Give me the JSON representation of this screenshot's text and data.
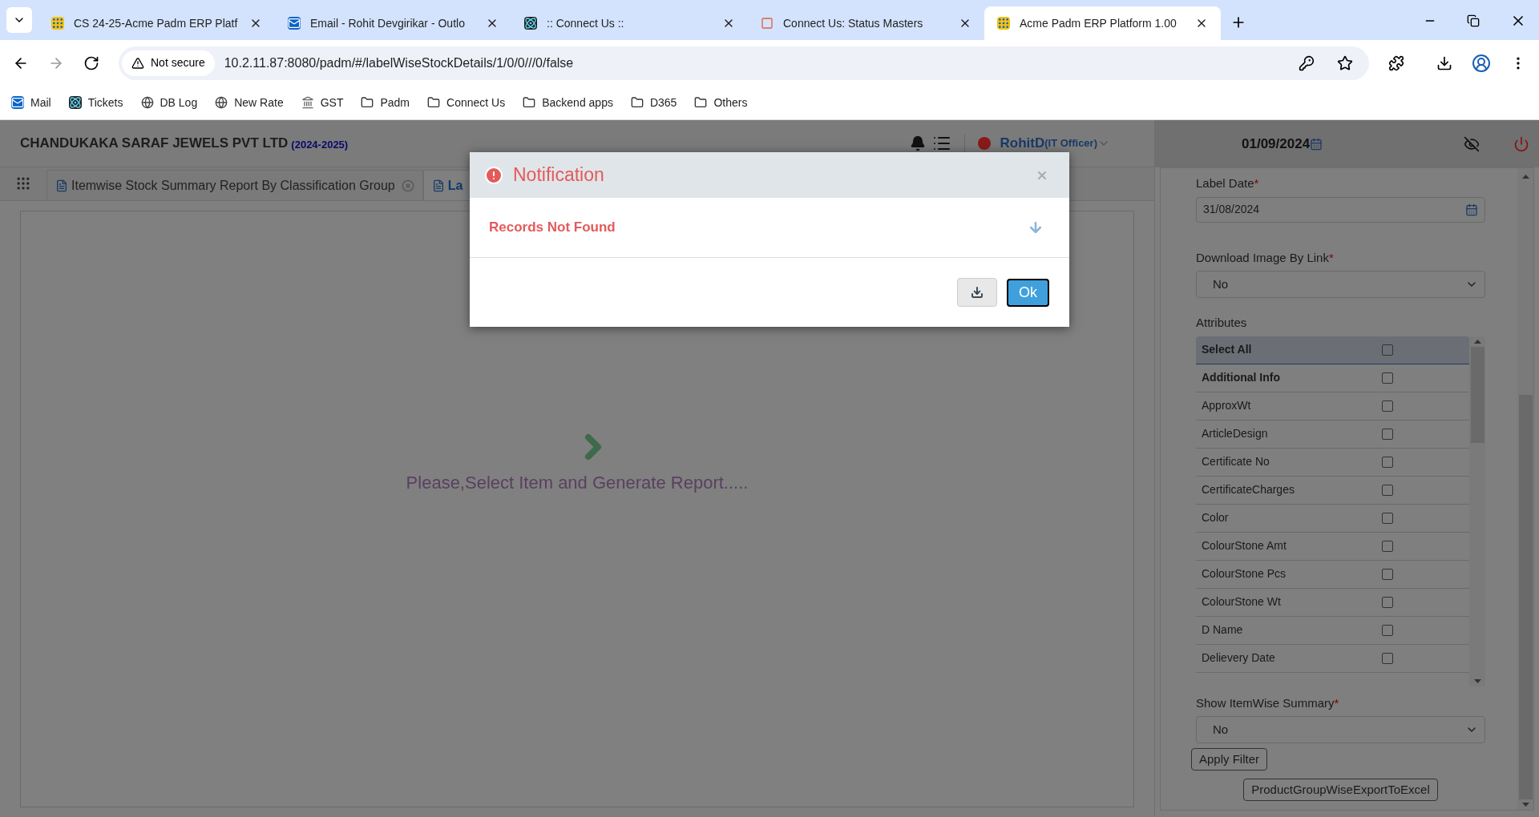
{
  "browser": {
    "tabs": [
      {
        "title": "CS 24-25-Acme Padm ERP Platf",
        "kind": "padm",
        "selected": false
      },
      {
        "title": "Email - Rohit Devgirikar - Outlo",
        "kind": "outlook",
        "selected": false
      },
      {
        "title": ":: Connect Us ::",
        "kind": "react",
        "selected": false
      },
      {
        "title": "Connect Us: Status Masters",
        "kind": "connect",
        "selected": false
      },
      {
        "title": "Acme Padm ERP Platform 1.00",
        "kind": "padm",
        "selected": true
      }
    ],
    "address": {
      "security": "Not secure",
      "url": "10.2.11.87:8080/padm/#/labelWiseStockDetails/1/0/0///0/false"
    },
    "bookmarks": [
      {
        "label": "Mail",
        "kind": "outlook"
      },
      {
        "label": "Tickets",
        "kind": "react"
      },
      {
        "label": "DB Log",
        "kind": "globe"
      },
      {
        "label": "New Rate",
        "kind": "globe"
      },
      {
        "label": "GST",
        "kind": "emblem"
      },
      {
        "label": "Padm",
        "kind": "folder"
      },
      {
        "label": "Connect Us",
        "kind": "folder"
      },
      {
        "label": "Backend apps",
        "kind": "folder"
      },
      {
        "label": "D365",
        "kind": "folder"
      },
      {
        "label": "Others",
        "kind": "folder"
      }
    ]
  },
  "app": {
    "company": "CHANDUKAKA SARAF JEWELS PVT LTD",
    "year": "(2024-2025)",
    "user": "RohitD",
    "role": "(IT Officer)",
    "date": "01/09/2024"
  },
  "tabs": [
    {
      "label": "Itemwise Stock Summary Report By Classification Group",
      "selected": false
    },
    {
      "label": "La",
      "selected": true
    }
  ],
  "main": {
    "message": "Please,Select Item and Generate Report....."
  },
  "filters": {
    "label_date": {
      "label": "Label Date",
      "required_mark": "*",
      "value": "31/08/2024"
    },
    "download_image": {
      "label": "Download Image By Link",
      "required_mark": "*",
      "value": "No"
    },
    "attributes": {
      "label": "Attributes",
      "items": [
        {
          "label": "Select All",
          "kind": "header",
          "checked": false
        },
        {
          "label": "Additional Info",
          "kind": "group",
          "checked": false
        },
        {
          "label": "ApproxWt",
          "kind": "item",
          "checked": false
        },
        {
          "label": "ArticleDesign",
          "kind": "item",
          "checked": false
        },
        {
          "label": "Certificate No",
          "kind": "item",
          "checked": false
        },
        {
          "label": "CertificateCharges",
          "kind": "item",
          "checked": false
        },
        {
          "label": "Color",
          "kind": "item",
          "checked": false
        },
        {
          "label": "ColourStone Amt",
          "kind": "item",
          "checked": false
        },
        {
          "label": "ColourStone Pcs",
          "kind": "item",
          "checked": false
        },
        {
          "label": "ColourStone Wt",
          "kind": "item",
          "checked": false
        },
        {
          "label": "D Name",
          "kind": "item",
          "checked": false
        },
        {
          "label": "Delievery Date",
          "kind": "item",
          "checked": false
        }
      ]
    },
    "summary": {
      "label": "Show ItemWise Summary",
      "required_mark": "*",
      "value": "No"
    },
    "buttons": [
      "Apply Filter",
      "ProductGroupWiseExportToExcel"
    ]
  },
  "dialog": {
    "title": "Notification",
    "message": "Records Not Found",
    "ok": "Ok"
  }
}
